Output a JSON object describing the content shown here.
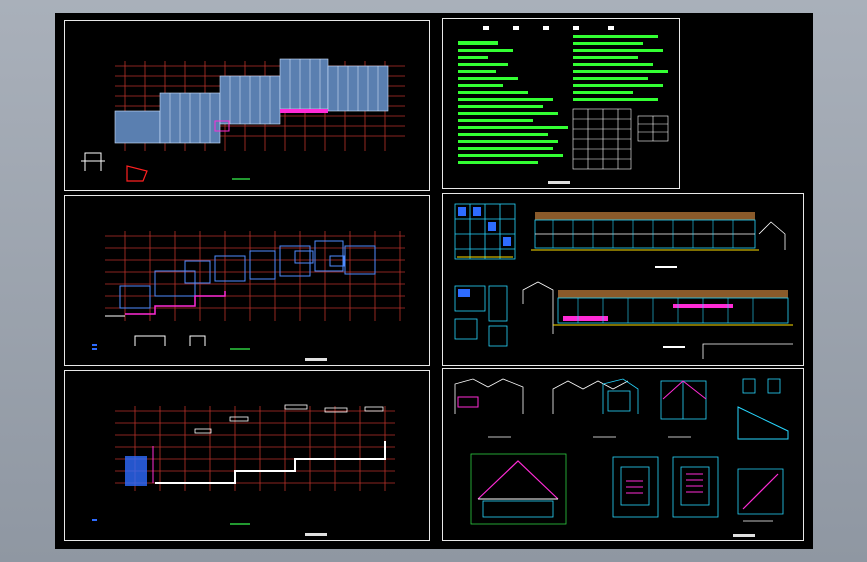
{
  "window": {
    "background": "#9aa1ab",
    "canvas_color": "#000000"
  },
  "colors": {
    "grid_red": "#c0392b",
    "grid_pink": "#d9607a",
    "wall_white": "#ffffff",
    "cyan": "#27d7ff",
    "blue": "#2e6cff",
    "green": "#2ecc40",
    "magenta": "#ff2bd6",
    "yellow": "#ffe000",
    "note_green": "#33ff33"
  },
  "sheets": [
    {
      "id": "plan-1",
      "name": "floor-plan-sheet-1"
    },
    {
      "id": "notes",
      "name": "design-notes-sheet"
    },
    {
      "id": "plan-2",
      "name": "floor-plan-sheet-2"
    },
    {
      "id": "elev",
      "name": "elevation-sheet"
    },
    {
      "id": "plan-3",
      "name": "floor-plan-sheet-3"
    },
    {
      "id": "detail",
      "name": "section-detail-sheet"
    }
  ]
}
